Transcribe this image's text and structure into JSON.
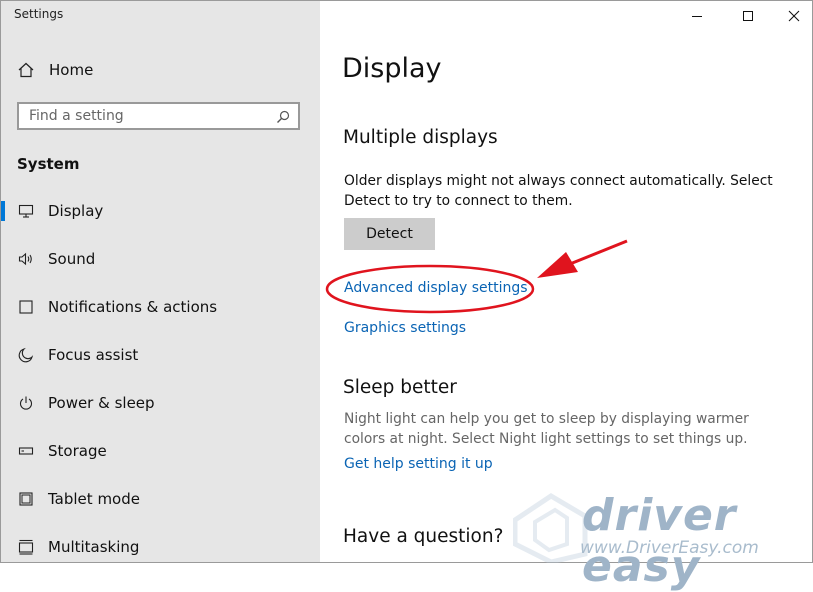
{
  "app": {
    "title": "Settings"
  },
  "sidebar": {
    "home_label": "Home",
    "search_placeholder": "Find a setting",
    "section": "System",
    "items": [
      {
        "label": "Display",
        "icon": "monitor-icon",
        "active": true
      },
      {
        "label": "Sound",
        "icon": "speaker-icon"
      },
      {
        "label": "Notifications & actions",
        "icon": "notification-icon"
      },
      {
        "label": "Focus assist",
        "icon": "moon-icon"
      },
      {
        "label": "Power & sleep",
        "icon": "power-icon"
      },
      {
        "label": "Storage",
        "icon": "storage-icon"
      },
      {
        "label": "Tablet mode",
        "icon": "tablet-icon"
      },
      {
        "label": "Multitasking",
        "icon": "multitasking-icon"
      }
    ]
  },
  "content": {
    "page_title": "Display",
    "multiple_displays": {
      "heading": "Multiple displays",
      "description": "Older displays might not always connect automatically. Select Detect to try to connect to them.",
      "detect_label": "Detect",
      "advanced_link": "Advanced display settings",
      "graphics_link": "Graphics settings"
    },
    "sleep_better": {
      "heading": "Sleep better",
      "description": "Night light can help you get to sleep by displaying warmer colors at night. Select Night light settings to set things up.",
      "help_link": "Get help setting it up"
    },
    "question": {
      "heading": "Have a question?"
    }
  },
  "watermark": {
    "brand": "driver easy",
    "url": "www.DriverEasy.com"
  },
  "colors": {
    "accent": "#0078d7",
    "link": "#0a64b4",
    "annotation": "#e0141e",
    "sidebar_bg": "#e6e6e6"
  }
}
